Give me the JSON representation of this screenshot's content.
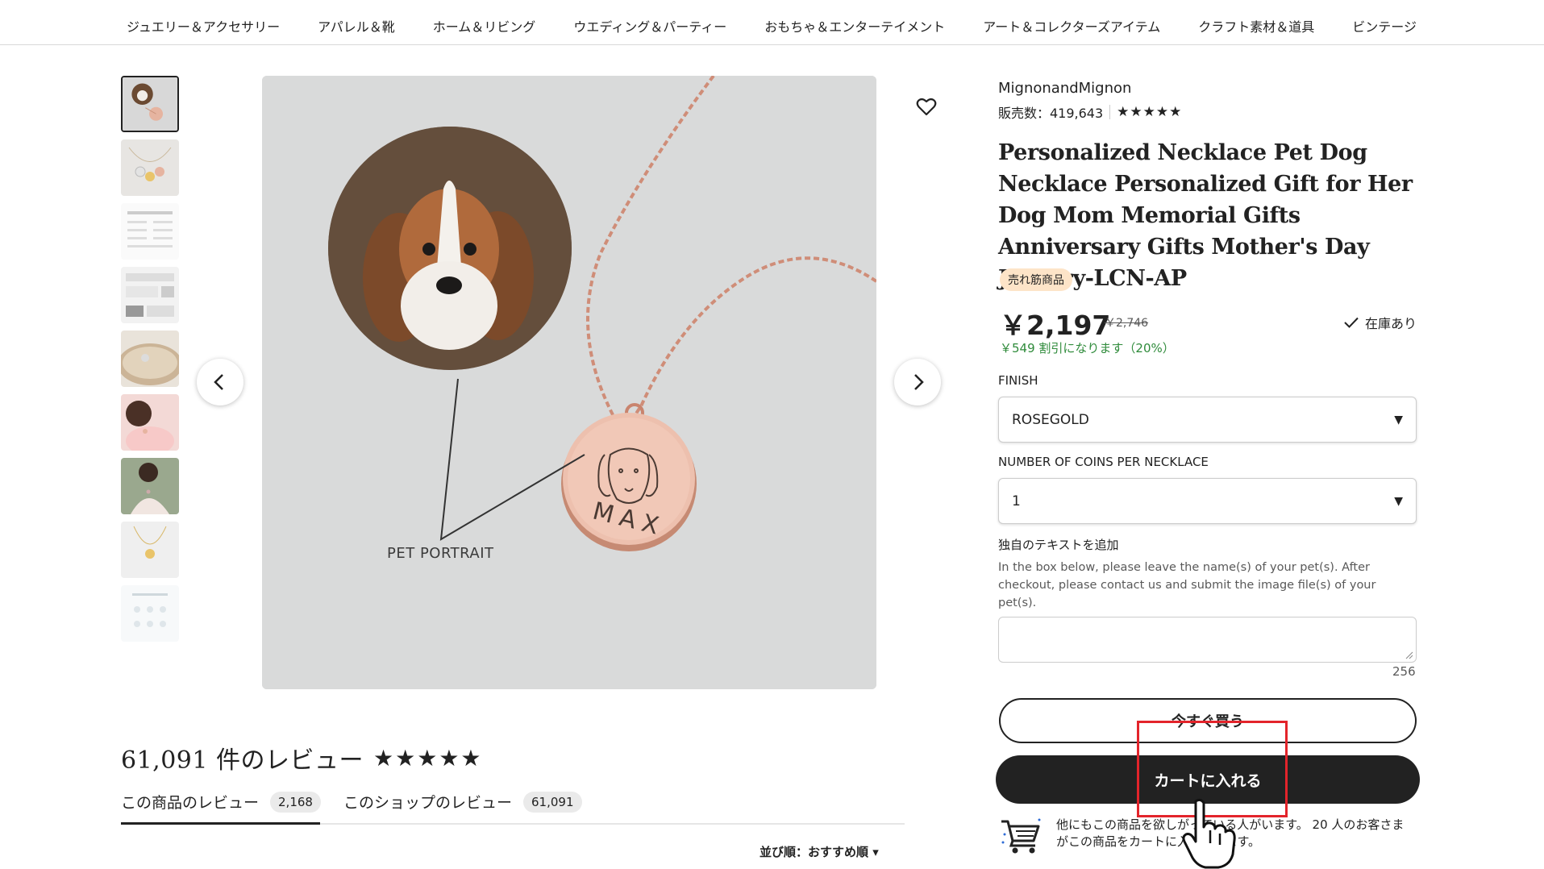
{
  "nav": {
    "items": [
      "ジュエリー＆アクセサリー",
      "アパレル＆靴",
      "ホーム＆リビング",
      "ウエディング＆パーティー",
      "おもちゃ＆エンターテイメント",
      "アート＆コレクターズアイテム",
      "クラフト素材＆道具",
      "ビンテージ"
    ]
  },
  "gallery": {
    "caption": "PET PORTRAIT",
    "engraving": "MAX",
    "thumbnail_count": 9
  },
  "shop": {
    "name": "MignonandMignon",
    "sales": "販売数：419,643",
    "stars": "★★★★★"
  },
  "product": {
    "title": "Personalized Necklace Pet Dog Necklace Personalized Gift for Her Dog Mom Memorial Gifts Anniversary Gifts Mother's Day Jewelry-LCN-AP",
    "badge": "売れ筋商品",
    "price": "￥2,197",
    "old_price": "￥2,746",
    "stock": "在庫あり",
    "discount": "￥549 割引になります（20%）"
  },
  "options": {
    "finish_label": "FINISH",
    "finish_value": "ROSEGOLD",
    "coins_label": "NUMBER OF COINS PER NECKLACE",
    "coins_value": "1",
    "text_label": "独自のテキストを追加",
    "text_help": "In the box below, please leave the name(s) of your pet(s). After checkout, please contact us and submit the image file(s) of your pet(s).",
    "char_count": "256"
  },
  "actions": {
    "buy_now": "今すぐ買う",
    "add_to_cart": "カートに入れる"
  },
  "demand": {
    "text": "他にもこの商品を欲しがっている人がいます。 20 人のお客さまがこの商品をカートに入れています。"
  },
  "reviews": {
    "count": "61,091 件のレビュー",
    "stars": "★★★★★",
    "tab_item_label": "この商品のレビュー",
    "tab_item_count": "2,168",
    "tab_shop_label": "このショップのレビュー",
    "tab_shop_count": "61,091",
    "sort": "並び順：おすすめ順"
  },
  "colors": {
    "accent": "#222222",
    "bestseller_bg": "#fde4c8",
    "discount": "#2f8b3b",
    "highlight": "#e3242b"
  }
}
